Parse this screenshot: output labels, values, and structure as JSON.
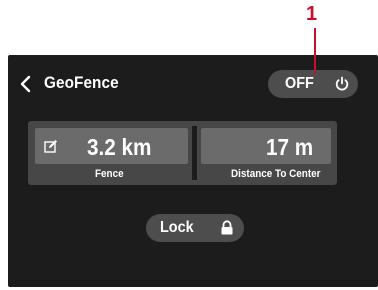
{
  "callout": {
    "number": "1",
    "color": "#c8102e"
  },
  "header": {
    "back_icon": "chevron-left-icon",
    "title": "GeoFence",
    "toggle": {
      "label": "OFF",
      "icon": "power-icon"
    }
  },
  "info": {
    "fence": {
      "icon": "edit-icon",
      "value": "3.2 km",
      "label": "Fence"
    },
    "distance": {
      "value": "17 m",
      "label": "Distance To Center"
    }
  },
  "lock_button": {
    "label": "Lock",
    "icon": "lock-icon"
  },
  "colors": {
    "panel_bg": "#1c1c1c",
    "button_bg": "#4d4d4d",
    "info_bg": "#474747",
    "cell_bg": "#6b6b6b",
    "text": "#ffffff"
  }
}
